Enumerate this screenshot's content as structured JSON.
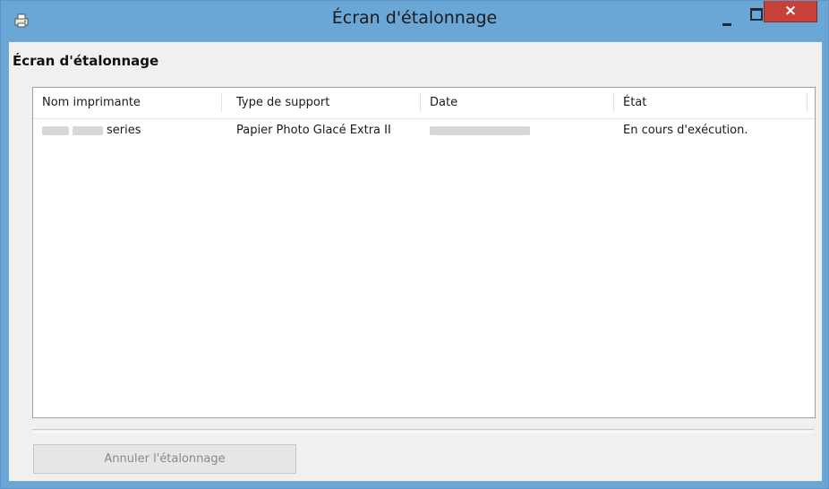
{
  "window": {
    "title": "Écran d'étalonnage",
    "close_glyph": "×",
    "app_icon": "printer-app-icon"
  },
  "section": {
    "label": "Écran d'étalonnage"
  },
  "table": {
    "columns": [
      "Nom imprimante",
      "Type de support",
      "Date",
      "État"
    ],
    "rows": [
      {
        "printer_suffix": "series",
        "media_type": "Papier Photo Glacé Extra II",
        "date": "",
        "status": "En cours d'exécution."
      }
    ]
  },
  "buttons": {
    "cancel": "Annuler l'étalonnage"
  },
  "colors": {
    "titlebar": "#6aa6d6",
    "close_button": "#c6413a",
    "client_background": "#f0f0f0"
  }
}
